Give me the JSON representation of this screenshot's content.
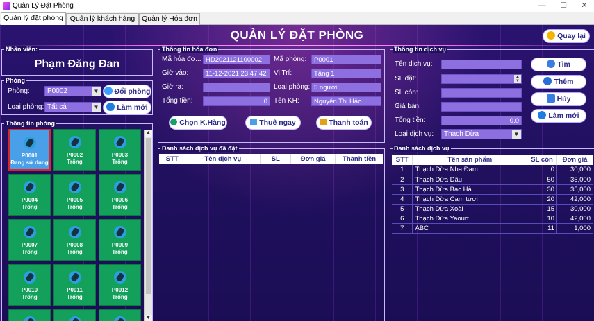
{
  "window": {
    "title": "Quản Lý Đặt Phòng",
    "minimize": "—",
    "maximize": "☐",
    "close": "✕"
  },
  "tabs": [
    "Quản lý đặt phòng",
    "Quản lý khách hàng",
    "Quản lý Hóa đơn"
  ],
  "header": {
    "title": "QUẢN LÝ ĐẶT PHÒNG",
    "back_button": "Quay lại"
  },
  "staff": {
    "section": "Nhân viên:",
    "name": "Phạm Đăng Đan"
  },
  "room_filter": {
    "section": "Phòng",
    "room_label": "Phòng:",
    "room_value": "P0002",
    "type_label": "Loại phòng:",
    "type_value": "Tất cả",
    "change_button": "Đổi phòng",
    "refresh_button": "Làm mới"
  },
  "room_info": {
    "section": "Thông tin phòng",
    "rooms": [
      {
        "id": "P0001",
        "status": "Đang sử dụng"
      },
      {
        "id": "P0002",
        "status": "Trống"
      },
      {
        "id": "P0003",
        "status": "Trống"
      },
      {
        "id": "P0004",
        "status": "Trống"
      },
      {
        "id": "P0005",
        "status": "Trống"
      },
      {
        "id": "P0006",
        "status": "Trống"
      },
      {
        "id": "P0007",
        "status": "Trống"
      },
      {
        "id": "P0008",
        "status": "Trống"
      },
      {
        "id": "P0009",
        "status": "Trống"
      },
      {
        "id": "P0010",
        "status": "Trống"
      },
      {
        "id": "P0011",
        "status": "Trống"
      },
      {
        "id": "P0012",
        "status": "Trống"
      }
    ]
  },
  "invoice": {
    "section": "Thông tin hóa đơn",
    "invoice_id_label": "Mã hóa đơ...",
    "invoice_id": "HD2021121100002",
    "room_id_label": "Mã phòng:",
    "room_id": "P0001",
    "checkin_label": "Giờ vào:",
    "checkin": "11-12-2021 23:47:42",
    "location_label": "Vị Trí:",
    "location": "Tầng 1",
    "checkout_label": "Giờ ra:",
    "checkout": "",
    "room_type_label": "Loại phòng:",
    "room_type": "5 người",
    "total_label": "Tổng tiền:",
    "total": "0",
    "customer_label": "Tên KH:",
    "customer": "Nguyễn Thị Hảo",
    "choose_customer_button": "Chọn K.Hàng",
    "rent_now_button": "Thuê ngay",
    "pay_button": "Thanh toán"
  },
  "booked_services": {
    "section": "Danh sách dịch vụ đã đặt",
    "columns": [
      "STT",
      "Tên dịch vụ",
      "SL",
      "Đơn giá",
      "Thành tiền"
    ],
    "rows": []
  },
  "service_info": {
    "section": "Thông tin dịch vụ",
    "name_label": "Tên dịch vụ:",
    "name": "",
    "qty_label": "SL đặt:",
    "qty": "",
    "remaining_label": "SL còn:",
    "remaining": "",
    "price_label": "Giá bán:",
    "price": "",
    "total_label": "Tổng tiền:",
    "total": "0.0",
    "type_label": "Loại dịch vụ:",
    "type": "Thạch Dừa",
    "search_button": "Tìm",
    "add_button": "Thêm",
    "cancel_button": "Hủy",
    "refresh_button": "Làm mới"
  },
  "service_list": {
    "section": "Danh sách dịch vụ",
    "columns": [
      "STT",
      "Tên sản phẩm",
      "SL còn",
      "Đơn giá"
    ],
    "rows": [
      [
        "1",
        "Thạch Dừa Nha Đam",
        "0",
        "30,000"
      ],
      [
        "2",
        "Thạch Dừa Dâu",
        "50",
        "35,000"
      ],
      [
        "3",
        "Thạch Dừa Bạc Hà",
        "30",
        "35,000"
      ],
      [
        "4",
        "Thạch Dừa Cam tươi",
        "20",
        "42,000"
      ],
      [
        "5",
        "Thạch Dừa Xoài",
        "15",
        "30,000"
      ],
      [
        "6",
        "Thạch Dừa Yaourt",
        "10",
        "42,000"
      ],
      [
        "7",
        "ABC",
        "11",
        "1,000"
      ]
    ]
  }
}
